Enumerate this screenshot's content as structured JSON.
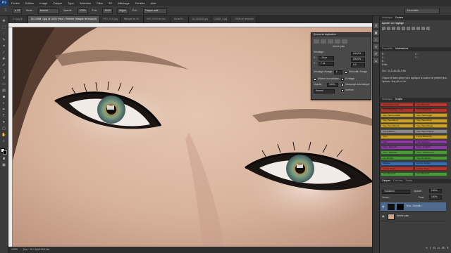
{
  "app": {
    "logo": "Ps"
  },
  "menu": [
    "Fichier",
    "Edition",
    "Image",
    "Calque",
    "Type",
    "Sélection",
    "Filtre",
    "3D",
    "Affichage",
    "Fenêtre",
    "Aide"
  ],
  "options": {
    "mode_label": "Mode :",
    "mode_value": "Normal",
    "opacity_label": "Opacité :",
    "opacity_value": "100%",
    "flow_label": "Flux :",
    "flow_value": "100%",
    "align_label": "Aligné",
    "sample_label": "Éch. :",
    "sample_value": "Calque actif"
  },
  "workspace": "Essentiels",
  "tabs": [
    "...12.jpg @...",
    "25-C0988_1.jpg @ 100% (Yeux - Eteindre, Masque de fusion/8)",
    "PSD_0 (1).jpg",
    "Masque de 29...",
    "IMG_0024 de vos ...",
    "Dossi fin ...",
    "26-1903ND.jpg",
    "C0982_1.jpg",
    "...2008 de retouche"
  ],
  "status": {
    "zoom": "100%",
    "doc": "Doc : 10,1 Mo/126,4 Mo"
  },
  "clone_source": {
    "title": "Source de duplication",
    "file": "Arrière-plan",
    "decalage": "Décalage :",
    "x_label": "X :",
    "x_value": "-18 px",
    "y_label": "Y :",
    "y_value": "7 px",
    "w_value": "100,0%",
    "h_value": "100,0%",
    "angle_value": "0,0",
    "frame_label": "Décalage d'image :",
    "frame_value": "0",
    "lock_frame": "Verrouiller l'image",
    "show_overlay": "Afficher l'incrustation",
    "opacity_label": "Opacité :",
    "opacity_value": "100%",
    "mode_value": "Normal",
    "clipped": "Ecrêtage",
    "auto_hide": "Masquage automatique",
    "invert": "Inverser"
  },
  "panels": {
    "top_tabs": [
      "Historique",
      "Couleur"
    ],
    "adjust_title": "Ajouter un réglage",
    "props_tabs": [
      "Propriétés",
      "Informations"
    ],
    "info_text": [
      "R :",
      "V :",
      "B :",
      "8 bits",
      "X :",
      "Y :",
      "Doc : 10,1 Mo/126,4 Mo",
      "Cliquez et faites glisser pour appliquer la couleur de premier plan. Options : Maj, Alt et Ctrl."
    ],
    "actions_tabs": [
      "Historique",
      "Scripts"
    ],
    "actions": [
      {
        "left": "Anti-Reflets Ford",
        "right": "Yeux Blanchir"
      },
      {
        "left": "Yeux Maquillage Ford",
        "right": "Yeux Maquillage"
      },
      {
        "left": "Yeux Teint Lumière",
        "right": "Yeux Teint Léger"
      },
      {
        "left": "Yeux Teint Brunir",
        "right": "Yeux Teint Rosé"
      },
      {
        "left": "Yeux Teint Bronzé",
        "right": "Yeux Teint Rouge"
      },
      {
        "left": "Anti Brillance",
        "right": "Yeux Teint Orangé"
      },
      {
        "left": "Yeux ...",
        "right": "Fonds Rétouche"
      },
      {
        "left": "Pole",
        "right": "Pole Intensive"
      },
      {
        "left": "Yeux - Eteindre",
        "right": "Yeux - Éclaircir"
      },
      {
        "left": "Yeux - Eteindre",
        "right": "Yeux - Chatoiment"
      },
      {
        "left": "Lèv. Border",
        "right": "Yeux de Border"
      },
      {
        "left": "Masque",
        "right": "Lèvres douces"
      },
      {
        "left": "Lèvres Gloss",
        "right": "Lèvres Gloss"
      },
      {
        "left": "Yeux Blanchir",
        "right": "Yeux Blanchir"
      }
    ],
    "layers_tabs": [
      "Calques",
      "Couches",
      "Tracés"
    ],
    "blend_mode": "Transform",
    "layer_opacity_label": "Opacité :",
    "layer_opacity_value": "100%",
    "lock_label": "Verrou :",
    "fill_label": "Fond :",
    "fill_value": "100%",
    "layers": [
      "Yeux - Eteindre",
      "Arrière-plan"
    ]
  }
}
